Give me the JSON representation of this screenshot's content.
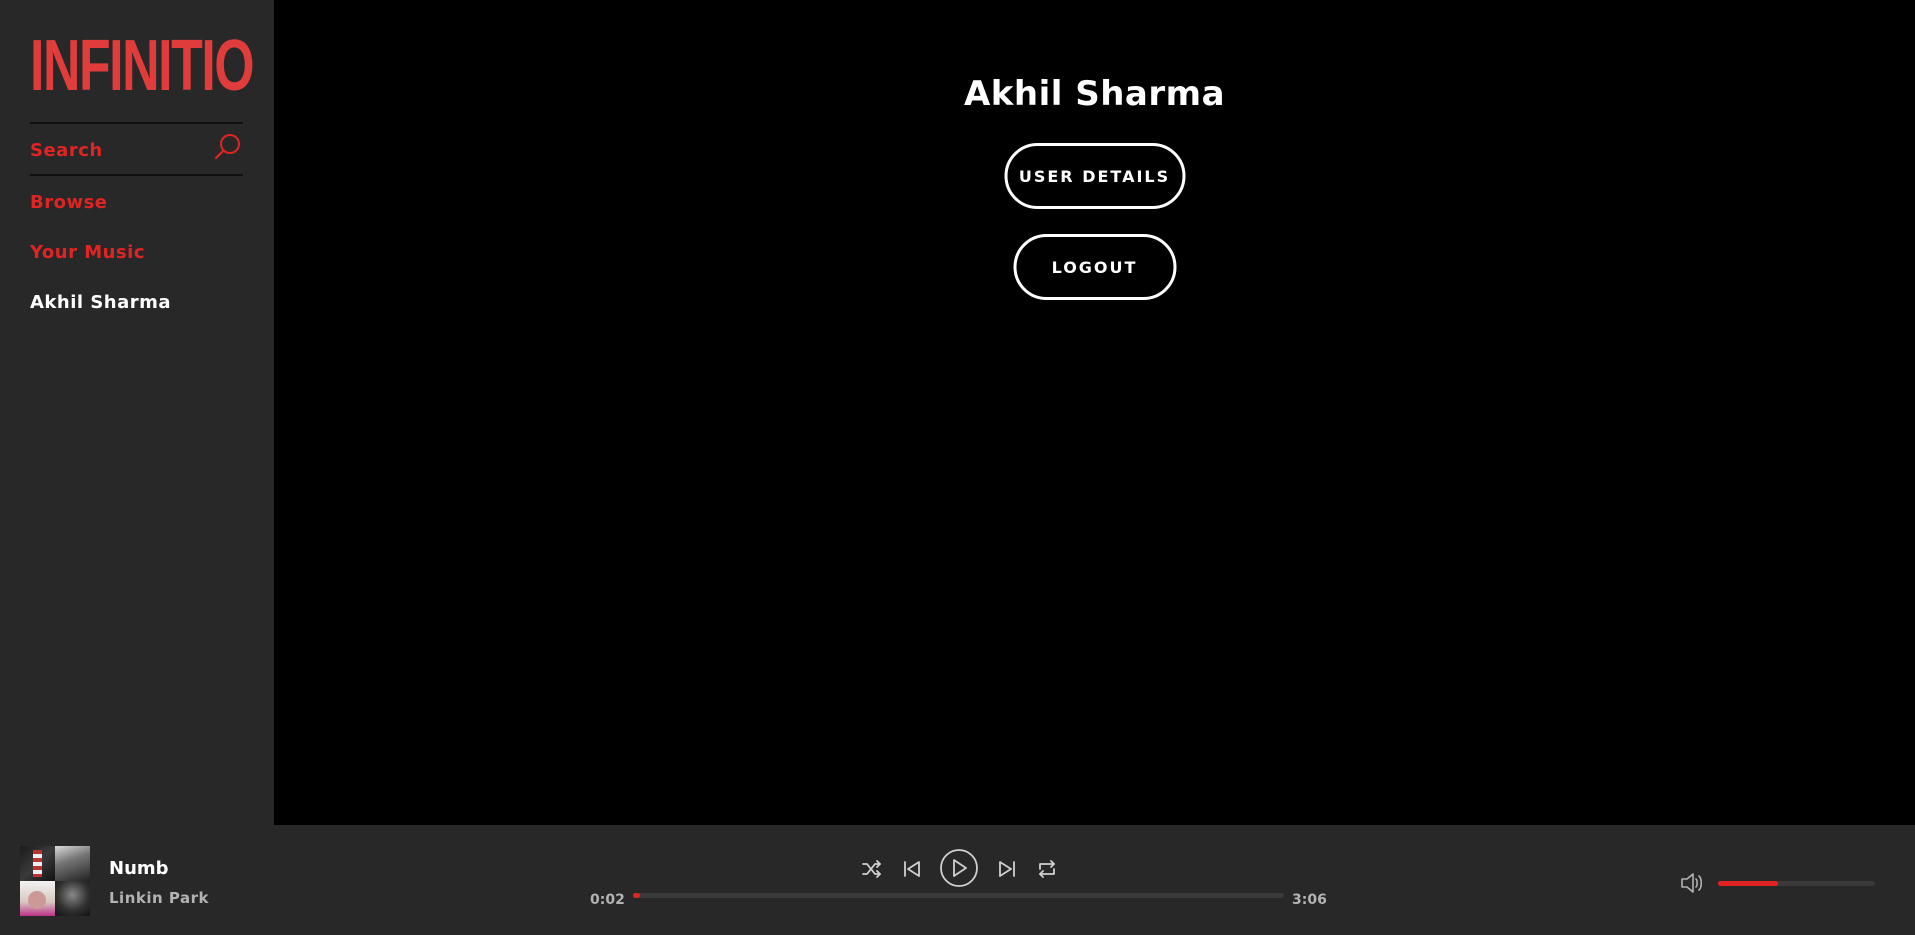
{
  "app": {
    "logo_text": "INFINITIO",
    "accent_color": "#e02424",
    "logo_color": "#e03c3c",
    "sidebar_bg": "#282828",
    "main_bg": "#000000"
  },
  "sidebar": {
    "search": {
      "label": "Search",
      "icon": "search-icon"
    },
    "items": [
      {
        "label": "Browse"
      },
      {
        "label": "Your Music"
      },
      {
        "label": "Akhil Sharma"
      }
    ]
  },
  "main": {
    "title": "Akhil Sharma",
    "user_details_label": "USER DETAILS",
    "logout_label": "LOGOUT"
  },
  "player": {
    "track": {
      "title": "Numb",
      "artist": "Linkin Park"
    },
    "album_art_icons": [
      "album-art-1",
      "album-art-2",
      "album-art-3",
      "album-art-4"
    ],
    "controls": {
      "shuffle": "shuffle-icon",
      "previous": "skip-previous-icon",
      "play": "play-icon",
      "next": "skip-next-icon",
      "repeat": "repeat-icon"
    },
    "time_current": "0:02",
    "time_total": "3:06",
    "progress_fraction": 0.011,
    "volume_icon": "volume-icon",
    "volume_fraction": 0.38
  }
}
